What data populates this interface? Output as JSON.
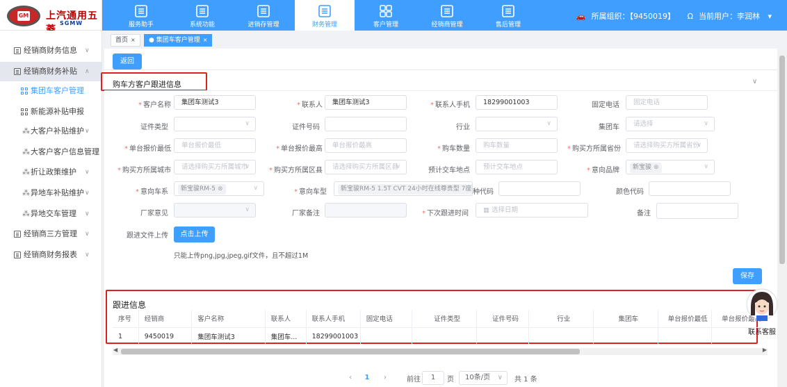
{
  "brand": {
    "name_cn": "上汽通用五菱",
    "name_en": "SGMW",
    "badge": "GM"
  },
  "nav": [
    {
      "label": "服务助手",
      "icon": "service-icon"
    },
    {
      "label": "系统功能",
      "icon": "system-icon"
    },
    {
      "label": "进销存管理",
      "icon": "inventory-icon"
    },
    {
      "label": "财务管理",
      "icon": "finance-icon",
      "active": true
    },
    {
      "label": "客户管理",
      "icon": "customer-icon"
    },
    {
      "label": "经销商管理",
      "icon": "dealer-icon"
    },
    {
      "label": "售后管理",
      "icon": "after-sales-icon"
    }
  ],
  "header": {
    "org_label": "所属组织：【9450019】",
    "user_label": "当前用户：李润林"
  },
  "sidebar": {
    "items": [
      {
        "label": "经销商财务信息",
        "level": 1,
        "arrow": "∨"
      },
      {
        "label": "经销商财务补贴",
        "level": 1,
        "arrow": "∧",
        "open": true
      },
      {
        "label": "集团车客户管理",
        "level": 2,
        "active": true
      },
      {
        "label": "新能源补贴申报",
        "level": 2
      },
      {
        "label": "大客户补贴维护",
        "level": 2,
        "arrow": "∨"
      },
      {
        "label": "大客户客户信息管理",
        "level": 2
      },
      {
        "label": "折让政策维护",
        "level": 2,
        "arrow": "∨"
      },
      {
        "label": "异地车补贴维护",
        "level": 2,
        "arrow": "∨"
      },
      {
        "label": "异地交车管理",
        "level": 2,
        "arrow": "∨"
      },
      {
        "label": "经销商三方管理",
        "level": 1,
        "arrow": "∨"
      },
      {
        "label": "经销商财务报表",
        "level": 1,
        "arrow": "∨"
      }
    ]
  },
  "tags": [
    {
      "label": "首页",
      "close": "×"
    },
    {
      "label": "集团车客户管理",
      "close": "×",
      "active": true
    }
  ],
  "back_button": "返回",
  "section_title": "购车方客户跟进信息",
  "form": {
    "customer_name": {
      "label": "客户名称",
      "value": "集团车测试3",
      "required": true
    },
    "contact": {
      "label": "联系人",
      "value": "集团车测试3",
      "required": true
    },
    "contact_phone": {
      "label": "联系人手机",
      "value": "18299001003",
      "required": true
    },
    "landline": {
      "label": "固定电话",
      "placeholder": "固定电话"
    },
    "id_type": {
      "label": "证件类型",
      "value": ""
    },
    "id_number": {
      "label": "证件号码",
      "value": ""
    },
    "industry": {
      "label": "行业",
      "value": ""
    },
    "group_car": {
      "label": "集团车",
      "placeholder": "请选择"
    },
    "min_price": {
      "label": "单台报价最低",
      "placeholder": "单台报价最低",
      "required": true
    },
    "max_price": {
      "label": "单台报价最高",
      "placeholder": "单台报价最高",
      "required": true
    },
    "quantity": {
      "label": "购车数量",
      "placeholder": "购车数量",
      "required": true
    },
    "province": {
      "label": "购买方所属省份",
      "placeholder": "请选择购买方所属省份",
      "required": true
    },
    "city": {
      "label": "购买方所属城市",
      "placeholder": "请选择购买方所属城市",
      "required": true
    },
    "district": {
      "label": "购买方所属区县",
      "placeholder": "请选择购买方所属区县",
      "required": true
    },
    "delivery_place": {
      "label": "预计交车地点",
      "placeholder": "预计交车地点"
    },
    "brand": {
      "label": "意向品牌",
      "chip": "新宝骏",
      "required": true
    },
    "series": {
      "label": "意向车系",
      "chip": "新宝骏RM-5",
      "required": true
    },
    "model": {
      "label": "意向车型",
      "chip": "新宝骏RM-5 1.5T CVT 24小时在线尊贵型 7座",
      "required": true
    },
    "color_code": {
      "label": "颜色代码",
      "value": ""
    },
    "factory_opinion": {
      "label": "厂家意见",
      "value": ""
    },
    "factory_note": {
      "label": "厂家备注",
      "value": ""
    },
    "next_follow_time": {
      "label": "下次跟进时间",
      "placeholder": "选择日期",
      "required": true
    },
    "remark": {
      "label": "备注",
      "value": ""
    },
    "upload": {
      "label": "跟进文件上传",
      "button": "点击上传",
      "hint": "只能上传png,jpg,jpeg,gif文件，且不超过1M"
    }
  },
  "save_button": "保存",
  "followup": {
    "title": "跟进信息",
    "columns": [
      "序号",
      "经销商",
      "客户名称",
      "联系人",
      "联系人手机",
      "固定电话",
      "证件类型",
      "证件号码",
      "行业",
      "集团车",
      "单台报价最低",
      "单台报价最高"
    ],
    "rows": [
      [
        "1",
        "9450019",
        "集团车测试3",
        "集团车...",
        "18299001003",
        "",
        "",
        "",
        "",
        "",
        "",
        ""
      ]
    ]
  },
  "pagination": {
    "current": "1",
    "goto_label": "前往",
    "goto_value": "1",
    "page_label": "页",
    "size": "10条/页",
    "total": "共 1 条"
  },
  "support": {
    "label": "联系客服"
  },
  "colors": {
    "primary": "#409eff",
    "danger": "#e02020",
    "brand_red": "#c62828"
  }
}
